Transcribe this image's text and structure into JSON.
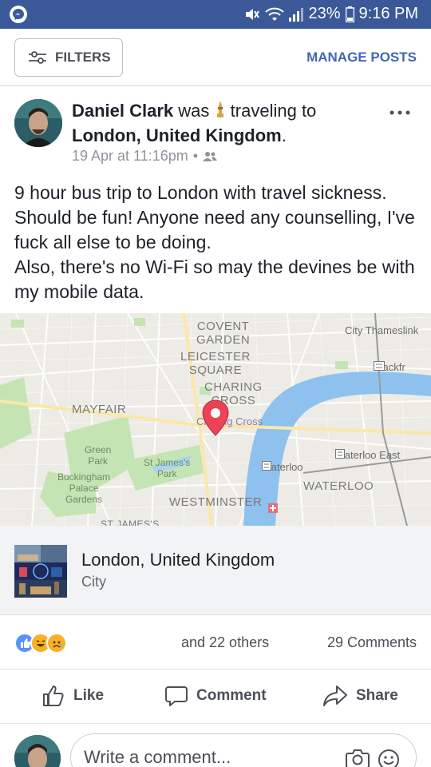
{
  "status_bar": {
    "battery": "23%",
    "time": "9:16 PM",
    "icons": [
      "messenger-icon",
      "mute-icon",
      "wifi-icon",
      "signal-icon",
      "battery-icon"
    ]
  },
  "toolbar": {
    "filters_label": "FILTERS",
    "manage_posts_label": "MANAGE POSTS"
  },
  "post": {
    "author": "Daniel Clark",
    "was": "was",
    "activity": "traveling to",
    "destination": "London, United Kingdom",
    "period": ".",
    "timestamp": "19 Apr at 11:16pm",
    "separator": "•",
    "audience_icon": "friends-icon",
    "text": "9 hour bus trip to London with travel sickness. Should be fun! Anyone need any counselling, I've fuck all else to be doing.\nAlso, there's no Wi-Fi so may the devines be with my mobile data."
  },
  "map": {
    "labels": {
      "covent_garden": "COVENT\nGARDEN",
      "leicester_square": "LEICESTER\nSQUARE",
      "charing_cross_area": "CHARING\nCROSS",
      "mayfair": "MAYFAIR",
      "westminster": "WESTMINSTER",
      "waterloo": "WATERLOO",
      "st_james": "ST JAMES'S"
    },
    "parks": {
      "green_park": "Green\nPark",
      "st_james_park": "St James's\nPark",
      "buckingham": "Buckingham\nPalace\nGardens"
    },
    "stations": {
      "city_thameslink": "City Thameslink",
      "blackfriars": "Blackfr",
      "charing_cross": "Charing Cross",
      "waterloo_east": "Waterloo East",
      "waterloo": "Waterloo"
    }
  },
  "place": {
    "name": "London, United Kingdom",
    "type": "City"
  },
  "reactions": {
    "names": "and 22 others",
    "comments": "29 Comments",
    "types": [
      "like",
      "haha",
      "sad"
    ],
    "colors": {
      "like": "#5890ff",
      "haha": "#f7b125",
      "sad": "#f7b125"
    }
  },
  "actions": {
    "like": "Like",
    "comment": "Comment",
    "share": "Share"
  },
  "comment_box": {
    "placeholder": "Write a comment..."
  }
}
